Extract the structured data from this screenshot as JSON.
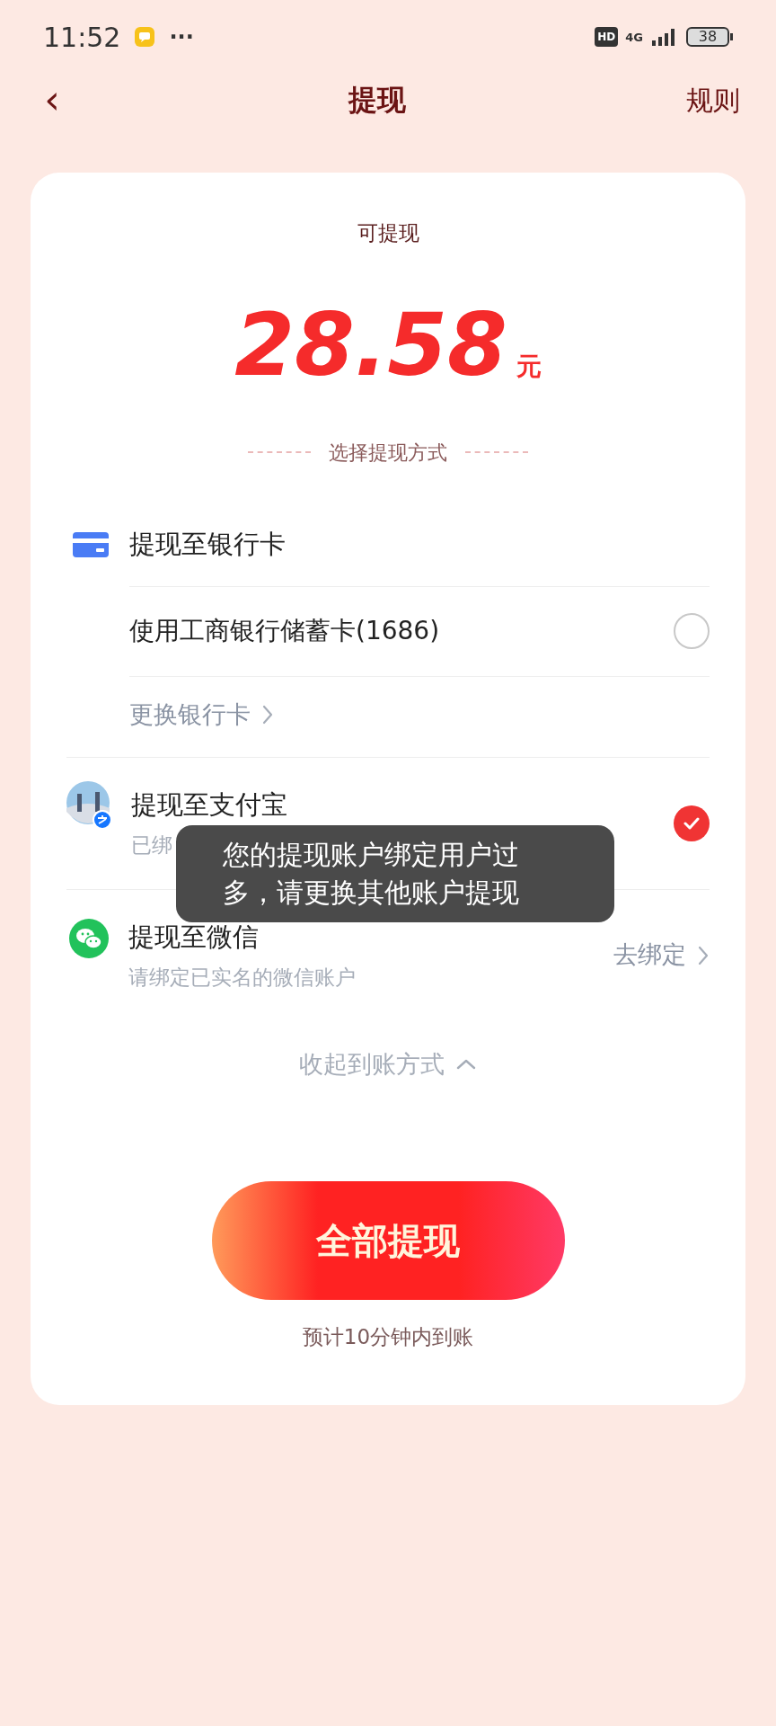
{
  "status_bar": {
    "time": "11:52",
    "more": "···",
    "hd": "HD",
    "network": "4G",
    "battery": "38"
  },
  "header": {
    "back": "‹",
    "title": "提现",
    "rules": "规则"
  },
  "balance": {
    "label": "可提现",
    "amount": "28.58",
    "unit": "元"
  },
  "section_title": "选择提现方式",
  "methods": [
    {
      "kind": "bank",
      "title": "提现至银行卡",
      "option": "使用工商银行储蓄卡(1686)",
      "selected": false,
      "change_link": "更换银行卡"
    },
    {
      "kind": "alipay",
      "title": "提现至支付宝",
      "subtitle": "已绑",
      "selected": true
    },
    {
      "kind": "wechat",
      "title": "提现至微信",
      "subtitle": "请绑定已实名的微信账户",
      "action": "去绑定"
    }
  ],
  "collapse": "收起到账方式",
  "withdraw_button": "全部提现",
  "eta": "预计10分钟内到账",
  "toast": "您的提现账户绑定用户过多，请更换其他账户提现"
}
